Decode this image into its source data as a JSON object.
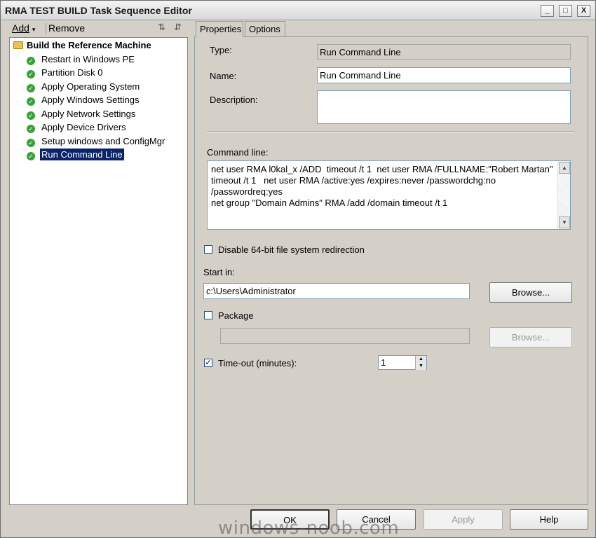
{
  "window": {
    "title": "RMA TEST BUILD Task Sequence Editor",
    "controls": {
      "minimize": "_",
      "maximize": "□",
      "close": "X"
    }
  },
  "toolbar": {
    "add_label": "Add",
    "add_arrow": "▾",
    "remove_label": "Remove"
  },
  "tree": {
    "root": "Build the Reference Machine",
    "items": [
      {
        "label": "Restart in Windows PE"
      },
      {
        "label": "Partition Disk 0"
      },
      {
        "label": "Apply Operating System"
      },
      {
        "label": "Apply Windows Settings"
      },
      {
        "label": "Apply Network Settings"
      },
      {
        "label": "Apply Device Drivers"
      },
      {
        "label": "Setup windows and ConfigMgr"
      },
      {
        "label": "Run Command Line",
        "selected": true
      }
    ]
  },
  "tabs": [
    {
      "label": "Properties",
      "active": true
    },
    {
      "label": "Options"
    }
  ],
  "properties": {
    "type_label": "Type:",
    "type_value": "Run Command Line",
    "name_label": "Name:",
    "name_value": "Run Command Line",
    "description_label": "Description:",
    "description_value": "",
    "command_label": "Command line:",
    "command_value": "net user RMA l0kal_x /ADD  timeout /t 1  net user RMA /FULLNAME:\"Robert Martan\" timeout /t 1   net user RMA /active:yes /expires:never /passwordchg:no /passwordreq:yes\nnet group \"Domain Admins\" RMA /add /domain timeout /t 1",
    "disable64_label": "Disable 64-bit file system redirection",
    "disable64_checked": false,
    "startin_label": "Start in:",
    "startin_value": "c:\\Users\\Administrator",
    "browse_label": "Browse...",
    "package_label": "Package",
    "package_checked": false,
    "package_value": "",
    "browse2_label": "Browse...",
    "timeout_label": "Time-out (minutes):",
    "timeout_checked": true,
    "timeout_value": "1"
  },
  "footer": {
    "ok": "OK",
    "cancel": "Cancel",
    "apply": "Apply",
    "help": "Help"
  },
  "watermark": "windows-noob.com"
}
